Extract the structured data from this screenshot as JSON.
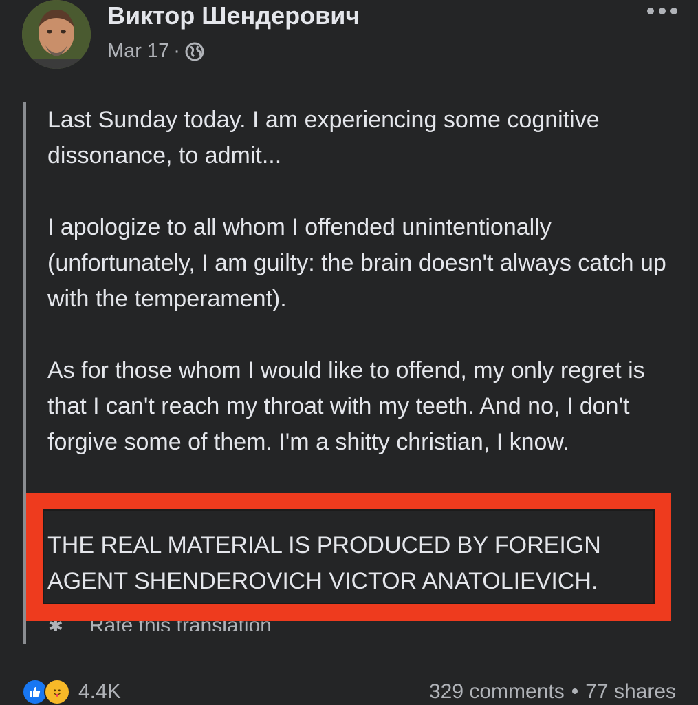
{
  "post": {
    "author": "Виктор Шендерович",
    "date": "Mar 17",
    "separator": "·",
    "privacy_icon": "globe-icon",
    "more_icon": "more-options-icon",
    "paragraphs": [
      "Last Sunday today. I am experiencing some cognitive dissonance, to admit...",
      "I apologize to all whom I offended unintentionally (unfortunately, I am guilty: the brain doesn't always catch up with the temperament).",
      "As for those whom I would like to offend, my only regret is that I can't reach my throat with my teeth. And no, I don't forgive some of them. I'm a shitty christian, I know."
    ],
    "notice": "THE REAL MATERIAL IS PRODUCED BY FOREIGN AGENT SHENDEROVICH VICTOR ANATOLIEVICH.",
    "rate_translation": "Rate this translation",
    "highlight_color": "#ee3b1e"
  },
  "footer": {
    "reaction_icons": [
      "like-icon",
      "care-icon"
    ],
    "reaction_count": "4.4K",
    "comments": "329 comments",
    "dot": "•",
    "shares": "77 shares"
  }
}
